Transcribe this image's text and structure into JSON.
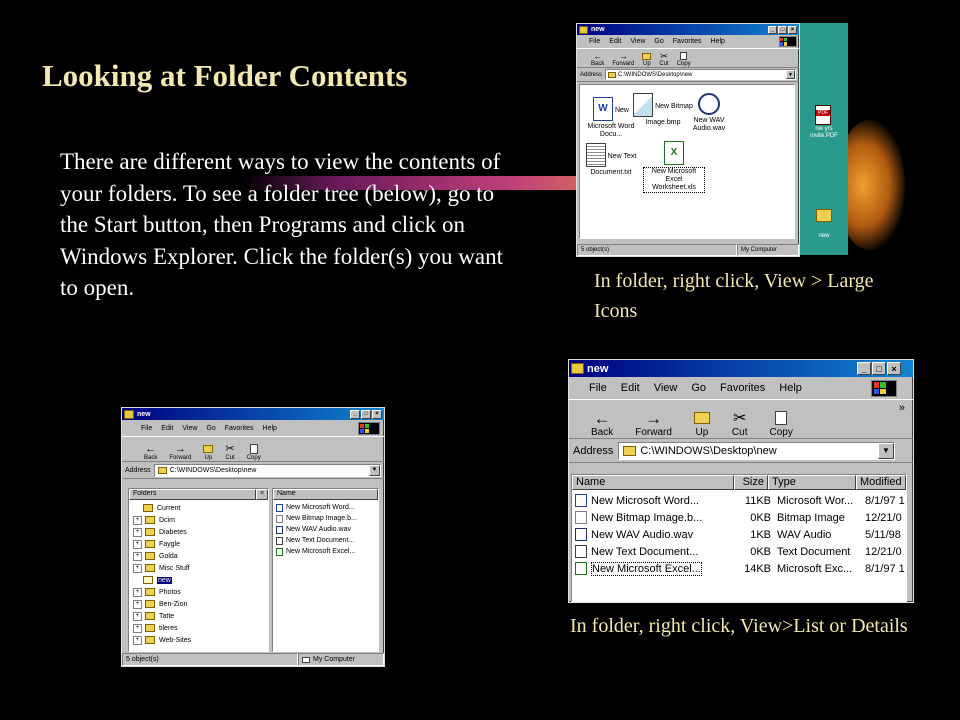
{
  "slide": {
    "title": "Looking at Folder Contents",
    "body": "There are different ways to view the contents of your folders. To see a folder tree (below), go to the Start button, then Programs and click on Windows Explorer. Click the folder(s) you want to open.",
    "caption_large_icons": "In folder, right click, View > Large Icons",
    "caption_list_details": "In folder, right click, View>List or Details"
  },
  "window": {
    "title": "new",
    "menu": [
      "File",
      "Edit",
      "View",
      "Go",
      "Favorites",
      "Help"
    ],
    "toolbar": {
      "back": "Back",
      "forward": "Forward",
      "up": "Up",
      "cut": "Cut",
      "copy": "Copy",
      "more": "»"
    },
    "address_label": "Address",
    "address": "C:\\WINDOWS\\Desktop\\new",
    "status_count": "5 object(s)",
    "status_location": "My Computer"
  },
  "large_icons": [
    {
      "name": "New Microsoft Word Docu..."
    },
    {
      "name": "New Bitmap Image.bmp"
    },
    {
      "name": "New WAV Audio.wav"
    },
    {
      "name": "New Text Document.txt"
    },
    {
      "name": "New Microsoft Excel Worksheet.xls"
    }
  ],
  "desktop": {
    "pdf_label": "nw yrs invite.PDF",
    "folder_label": "new"
  },
  "explorer": {
    "folders_header": "Folders",
    "name_header": "Name",
    "tree": [
      "Current",
      "Dcim",
      "Diabetes",
      "Faygle",
      "Golda",
      "Misc Stuff",
      "new",
      "Photos",
      "Ben-Zion",
      "Tatte",
      "tileres",
      "Web-Sites"
    ],
    "files": [
      "New Microsoft Word...",
      "New Bitmap Image.b...",
      "New WAV Audio.wav",
      "New Text Document...",
      "New Microsoft Excel..."
    ]
  },
  "details": {
    "columns": [
      "Name",
      "Size",
      "Type",
      "Modified"
    ],
    "rows": [
      {
        "name": "New Microsoft Word...",
        "size": "11KB",
        "type": "Microsoft Wor...",
        "modified": "8/1/97 1"
      },
      {
        "name": "New Bitmap Image.b...",
        "size": "0KB",
        "type": "Bitmap Image",
        "modified": "12/21/0"
      },
      {
        "name": "New WAV Audio.wav",
        "size": "1KB",
        "type": "WAV Audio",
        "modified": "5/11/98"
      },
      {
        "name": "New Text Document...",
        "size": "0KB",
        "type": "Text Document",
        "modified": "12/21/0"
      },
      {
        "name": "New Microsoft Excel...",
        "size": "14KB",
        "type": "Microsoft Exc...",
        "modified": "8/1/97 1"
      }
    ]
  },
  "colors": {
    "title": "#f2e8b0",
    "body": "#ffffff",
    "background": "#000000",
    "titlebar": "#000080"
  }
}
